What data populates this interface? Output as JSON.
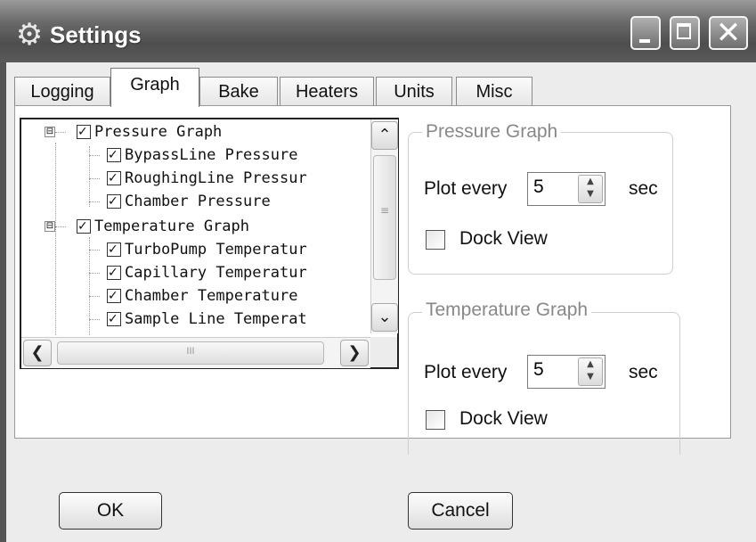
{
  "window": {
    "title": "Settings",
    "icon": "gear-icon"
  },
  "titlebar_buttons": {
    "minimize": "minimize",
    "maximize": "maximize",
    "close": "✕"
  },
  "tabs": [
    {
      "label": "Logging",
      "active": false
    },
    {
      "label": "Graph",
      "active": true
    },
    {
      "label": "Bake",
      "active": false
    },
    {
      "label": "Heaters",
      "active": false
    },
    {
      "label": "Units",
      "active": false
    },
    {
      "label": "Misc",
      "active": false
    }
  ],
  "tree": {
    "groups": [
      {
        "label": "Pressure Graph",
        "expander": "⊟",
        "checked": true,
        "children": [
          {
            "label": "BypassLine Pressure",
            "checked": true
          },
          {
            "label": "RoughingLine Pressur",
            "checked": true
          },
          {
            "label": "Chamber Pressure",
            "checked": true
          }
        ]
      },
      {
        "label": "Temperature Graph",
        "expander": "⊟",
        "checked": true,
        "children": [
          {
            "label": "TurboPump Temperatur",
            "checked": true
          },
          {
            "label": "Capillary Temperatur",
            "checked": true
          },
          {
            "label": "Chamber Temperature",
            "checked": true
          },
          {
            "label": "Sample Line Temperat",
            "checked": true
          }
        ]
      }
    ],
    "scroll": {
      "up": "⌃",
      "down": "⌄",
      "left": "❮",
      "right": "❯",
      "grip": "≡",
      "hgrip": "III"
    }
  },
  "pressure_group": {
    "title": "Pressure Graph",
    "plot_label": "Plot every",
    "value": "5",
    "unit": "sec",
    "dock_label": "Dock View",
    "dock_checked": false
  },
  "temperature_group": {
    "title": "Temperature Graph",
    "plot_label": "Plot every",
    "value": "5",
    "unit": "sec",
    "dock_label": "Dock View",
    "dock_checked": false
  },
  "buttons": {
    "ok": "OK",
    "cancel": "Cancel"
  },
  "spin_arrows": {
    "up": "▲",
    "down": "▼"
  }
}
